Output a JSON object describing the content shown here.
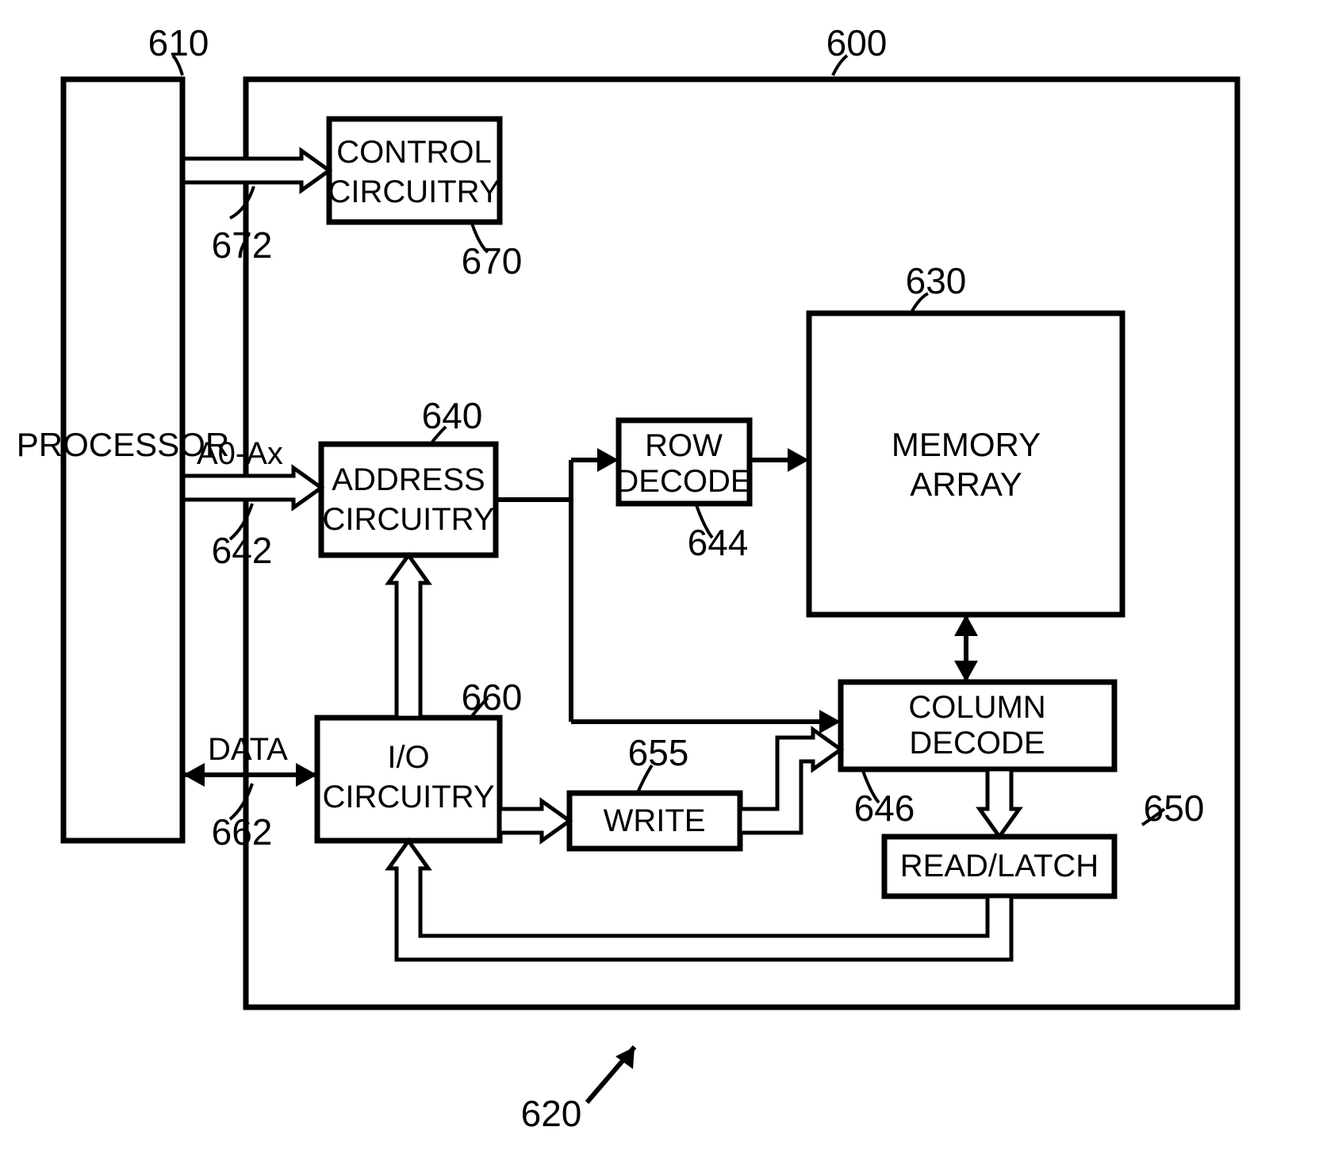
{
  "blocks": {
    "processor": "PROCESSOR",
    "control": [
      "CONTROL",
      "CIRCUITRY"
    ],
    "address": [
      "ADDRESS",
      "CIRCUITRY"
    ],
    "rowdecode": [
      "ROW",
      "DECODE"
    ],
    "memory": [
      "MEMORY",
      "ARRAY"
    ],
    "coldecode": [
      "COLUMN",
      "DECODE"
    ],
    "io": [
      "I/O",
      "CIRCUITRY"
    ],
    "write": "WRITE",
    "readlatch": "READ/LATCH"
  },
  "labels": {
    "addr_bus": "A0-Ax",
    "data_bus": "DATA"
  },
  "refs": {
    "processor": "610",
    "device": "600",
    "system": "620",
    "memory": "630",
    "address": "640",
    "addr_bus": "642",
    "rowdecode": "644",
    "coldecode": "646",
    "readlatch": "650",
    "write": "655",
    "io": "660",
    "data_bus": "662",
    "control": "670",
    "ctl_bus": "672"
  }
}
